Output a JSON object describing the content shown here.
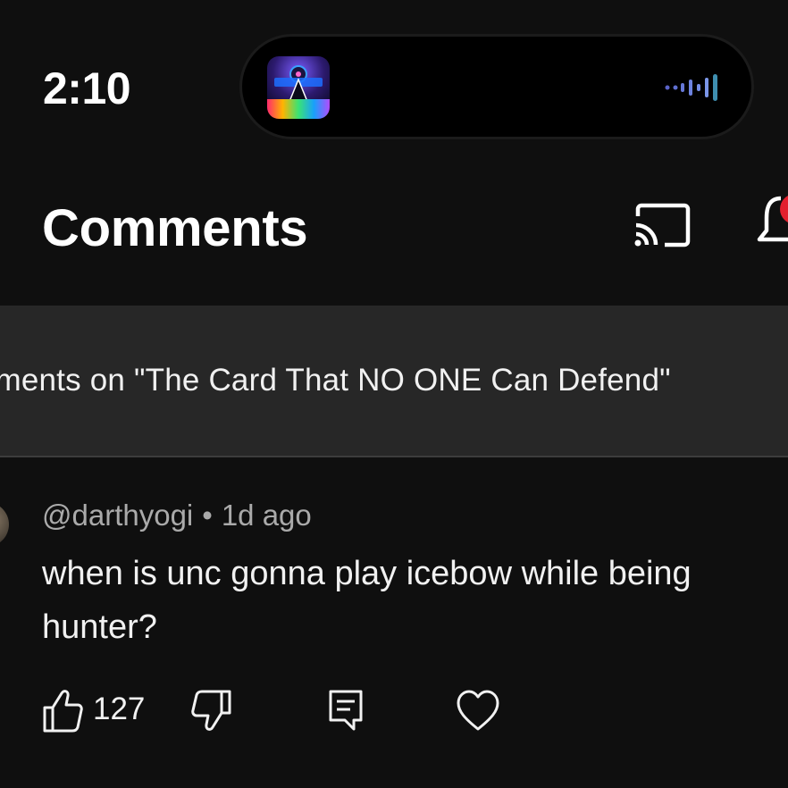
{
  "status_bar": {
    "time": "2:10",
    "now_playing_art": "album-art-thumbnail",
    "audio_indicator": "waveform-icon"
  },
  "header": {
    "title": "Comments",
    "icons": [
      "cast-icon",
      "notification-bell-icon"
    ]
  },
  "banner": {
    "text": "Comments on \"The Card That NO ONE Can Defend\""
  },
  "comment": {
    "author": "@darthyogi",
    "separator": "•",
    "time": "1d ago",
    "line1": "when is unc gonna play icebow while being",
    "line2": "hunter?",
    "like_count": "127"
  },
  "colors": {
    "background": "#0f0f0f",
    "banner": "#272727",
    "text_primary": "#f1f1f1",
    "text_secondary": "#aaaaaa",
    "badge": "#e3202e"
  }
}
